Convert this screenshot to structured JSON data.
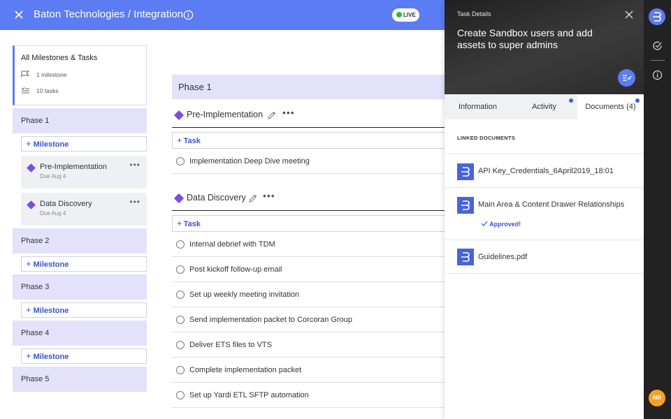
{
  "header": {
    "title": "Baton Technologies / Integration",
    "live_label": "LIVE"
  },
  "sidebar": {
    "all_title": "All Milestones & Tasks",
    "milestone_count": "1 milestone",
    "task_count": "10 tasks",
    "add_milestone_label": "Milestone",
    "phases": [
      {
        "label": "Phase 1"
      },
      {
        "label": "Phase 2"
      },
      {
        "label": "Phase 3"
      },
      {
        "label": "Phase 4"
      },
      {
        "label": "Phase 5"
      }
    ],
    "phase1_milestones": [
      {
        "name": "Pre-Implementation",
        "due": "Due Aug 4"
      },
      {
        "name": "Data Discovery",
        "due": "Due Aug 4"
      }
    ]
  },
  "main": {
    "phase_title": "Phase 1",
    "add_task_label": "Task",
    "milestones": [
      {
        "name": "Pre-Implementation",
        "tasks": [
          "Implementation Deep Dive meeting"
        ]
      },
      {
        "name": "Data Discovery",
        "tasks": [
          "Internal debrief with TDM",
          "Post kickoff follow-up email",
          "Set up weekly meeting invitation",
          "Send implementation packet to Corcoran Group",
          "Deliver ETS files to VTS",
          "Complete implementation packet",
          "Set up Yardi ETL SFTP automation"
        ]
      }
    ]
  },
  "drawer": {
    "label": "Task Details",
    "task_name": "Create Sandbox users and add assets to super admins",
    "tabs": [
      {
        "label": "Information"
      },
      {
        "label": "Activity"
      },
      {
        "label": "Documents (4)"
      }
    ],
    "linked_label": "LINKED DOCUMENTS",
    "documents": [
      {
        "name": "API Key_Credentials_6April2019_18:01"
      },
      {
        "name": "Main Area & Content Drawer Relationships",
        "status": "Approved!"
      },
      {
        "name": "Guidelines.pdf"
      }
    ]
  },
  "rail": {
    "avatar_initials": "MR"
  },
  "colors": {
    "header_blue": "#5b7cf2",
    "milestone_purple": "#7b4de4",
    "phase_bg": "#e3e2fa",
    "link_blue": "#3a55c9",
    "live_green": "#2bb34a",
    "avatar_orange": "#f6a126"
  }
}
